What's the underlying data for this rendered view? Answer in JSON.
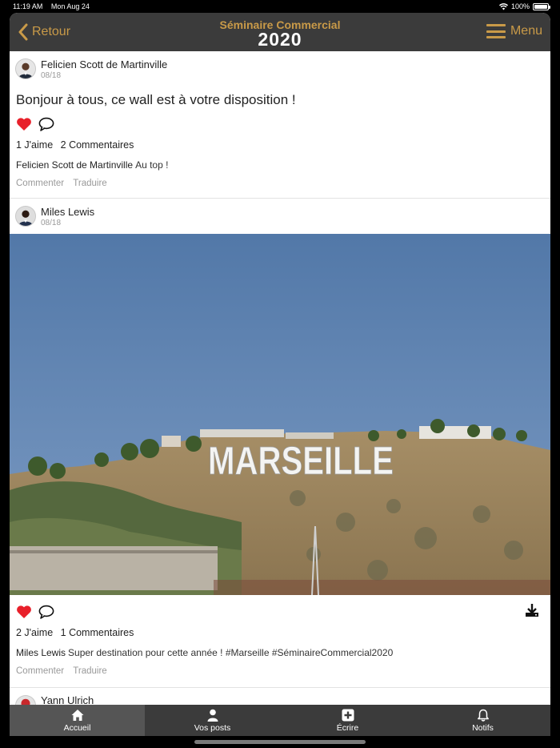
{
  "status": {
    "time": "11:19 AM",
    "date": "Mon Aug 24",
    "battery": "100%"
  },
  "header": {
    "back_label": "Retour",
    "title": "Séminaire Commercial",
    "year": "2020",
    "menu_label": "Menu"
  },
  "posts": [
    {
      "author": "Felicien Scott de Martinville",
      "date": "08/18",
      "text": "Bonjour à tous, ce wall est à votre disposition !",
      "likes": "1 J'aime",
      "comments_count": "2 Commentaires",
      "comment_author": "Felicien Scott de Martinville",
      "comment_text": "Au top !",
      "comment_action": "Commenter",
      "translate_action": "Traduire"
    },
    {
      "author": "Miles Lewis",
      "date": "08/18",
      "likes": "2 J'aime",
      "comments_count": "1 Commentaires",
      "comment_author": "Miles Lewis",
      "comment_text": "Super destination pour cette année ! #Marseille #SéminaireCommercial2020",
      "comment_action": "Commenter",
      "translate_action": "Traduire",
      "photo_sign": "MARSEILLE"
    },
    {
      "author": "Yann Ulrich"
    }
  ],
  "tabs": [
    {
      "label": "Accueil",
      "icon": "home-icon"
    },
    {
      "label": "Vos posts",
      "icon": "user-icon"
    },
    {
      "label": "Écrire",
      "icon": "plus-square-icon"
    },
    {
      "label": "Notifs",
      "icon": "bell-icon"
    }
  ],
  "colors": {
    "accent": "#c99a48",
    "header_bg": "#3b3b3b",
    "like_red": "#e8202a",
    "sky": "#5d80ad"
  }
}
